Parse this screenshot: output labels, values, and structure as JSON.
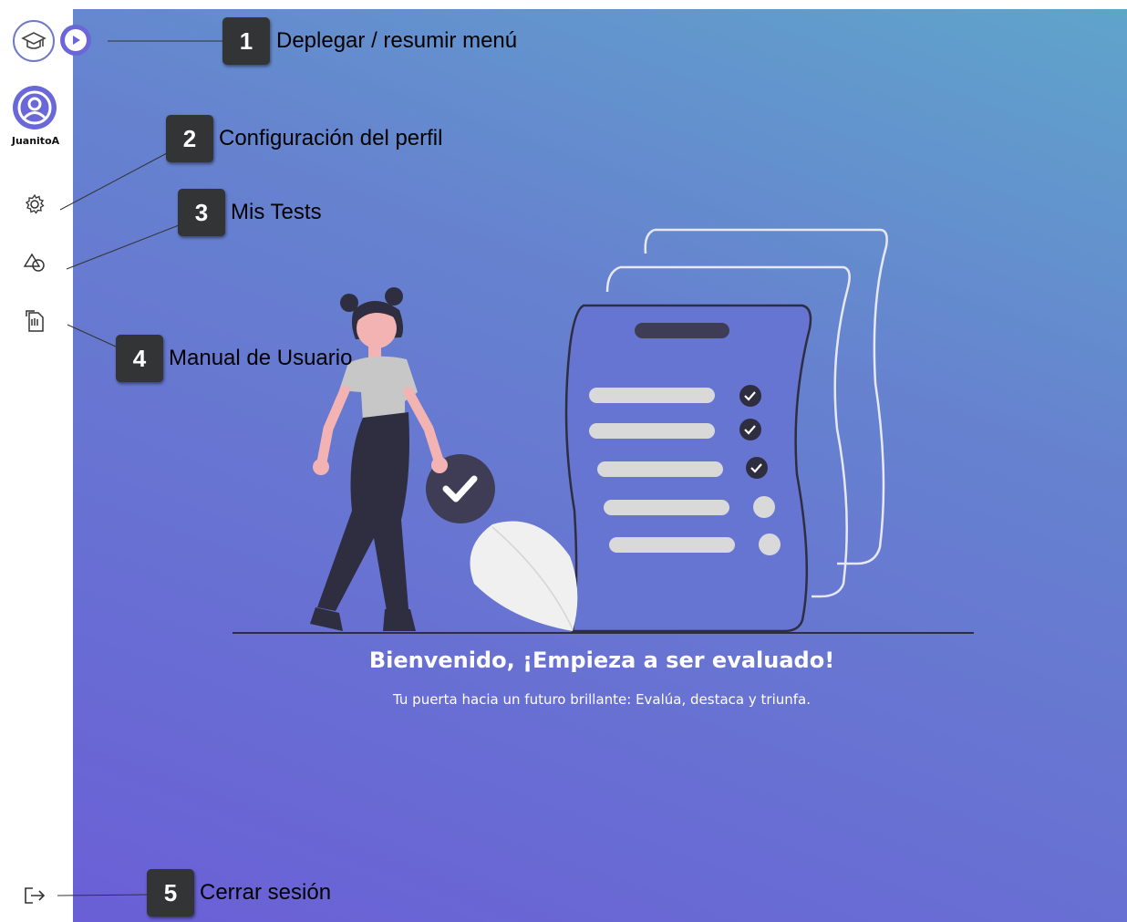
{
  "sidebar": {
    "logo_icon": "graduation-cap-icon",
    "toggle_icon": "play-circle-icon",
    "username": "JuanitoA",
    "items": [
      {
        "name": "settings",
        "icon": "gear-icon"
      },
      {
        "name": "tests",
        "icon": "shapes-icon"
      },
      {
        "name": "manual",
        "icon": "document-icon"
      },
      {
        "name": "logout",
        "icon": "logout-icon"
      }
    ],
    "accent_color": "#6a68d8"
  },
  "callouts": [
    {
      "number": "1",
      "label": "Deplegar / resumir menú"
    },
    {
      "number": "2",
      "label": "Configuración del perfil"
    },
    {
      "number": "3",
      "label": "Mis Tests"
    },
    {
      "number": "4",
      "label": "Manual de Usuario"
    },
    {
      "number": "5",
      "label": "Cerrar sesión"
    }
  ],
  "main": {
    "title": "Bienvenido, ¡Empieza a ser evaluado!",
    "subtitle": "Tu puerta hacia un futuro brillante: Evalúa, destaca y triunfa.",
    "illustration": "woman-with-checklist",
    "checklist_done": 3,
    "checklist_total": 5
  }
}
